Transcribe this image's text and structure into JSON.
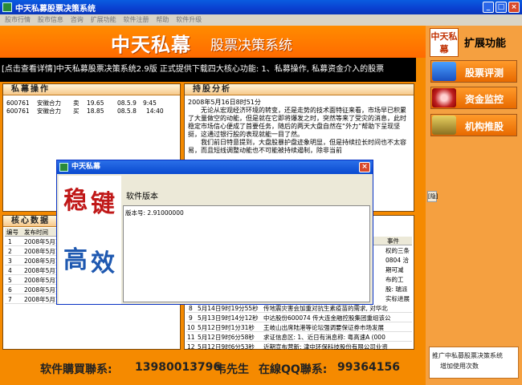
{
  "window": {
    "title": "中天私募股票决策系统",
    "min": "_",
    "max": "□",
    "close": "×"
  },
  "menu": [
    "股市行情",
    "股市信息",
    "咨询",
    "扩展功能",
    "软件注册",
    "帮助",
    "软件升级"
  ],
  "banner": {
    "big": "中天私幕",
    "small": "股票决策系统"
  },
  "ticker": "[点击查看详情]中天私募股票决策系统2.9版 正式提供下载四大核心功能: 1、私募操作, 私募资金介入的股票",
  "private_ops": {
    "title": "私幕操作",
    "rows": [
      {
        "code": "600761",
        "name": "安徽合力",
        "side": "卖",
        "price": "19.65",
        "date": "08.5.9",
        "time": "9:45"
      },
      {
        "code": "600761",
        "name": "安徽合力",
        "side": "买",
        "price": "18.85",
        "date": "08.5.8",
        "time": "14:40"
      }
    ]
  },
  "analysis": {
    "title": "持股分析",
    "date": "2008年5月16日8时51分",
    "paragraphs": [
      "无论从宏观经济环境的转变，还是走势的技术面特征来看，市场早已积累了大量做空的动能，但是就在它即将爆发之时，突然等来了受灾的消息，此时稳定市场信心便成了首要任务，随后的两天大盘自然在“外力”帮助下呈现坚挺，这通过银行股的表现就能一目了然。",
      "我们前日特意提到，大盘股暴护盘迹象明显，但是持续拉长时间也不太容易，而且短线调整动能也不可能被持续遏制，除非当前"
    ]
  },
  "core_data": {
    "title": "核心数据",
    "headers": [
      "编号",
      "发布时间"
    ],
    "rows": [
      {
        "no": "1",
        "time": "2008年5月16"
      },
      {
        "no": "2",
        "time": "2008年5月15"
      },
      {
        "no": "3",
        "time": "2008年5月15"
      },
      {
        "no": "4",
        "time": "2008年5月14"
      },
      {
        "no": "5",
        "time": "2008年5月13"
      },
      {
        "no": "6",
        "time": "2008年5月12"
      },
      {
        "no": "7",
        "time": "2008年5月12"
      }
    ]
  },
  "events": {
    "header_event": "事件",
    "partial_right": [
      "权的三条",
      "0804 洽",
      "期可减",
      "布的工",
      "股: 瑞派",
      "实标进展"
    ],
    "rows": [
      {
        "no": "8",
        "time": "5月14日9时19分55秒",
        "event": "传地震灾害会加重对抗生素疫苗的需求, 对华北"
      },
      {
        "no": "9",
        "time": "5月13日9时14分12秒",
        "event": "中达股份600074 传大连金融控股集团重组该公"
      },
      {
        "no": "10",
        "time": "5月12日9时1分31秒",
        "event": "王岐山出席陆港等论坛强调要保证券市场发展"
      },
      {
        "no": "11",
        "time": "5月12日9时6分58秒",
        "event": "求证信息区: 1、近日有消息称: 粤高速A (000"
      },
      {
        "no": "12",
        "time": "5月12日9时6分53秒",
        "event": "近期宣布营新: 津中环保科技股份有限公司业资"
      }
    ]
  },
  "footer": {
    "label": "软件購買聯系:",
    "phone": "13980013796",
    "contact": "韦先生",
    "qq_label": "在線QQ聯系:",
    "qq": "99364156"
  },
  "sidebar": {
    "logo": "中天私幕",
    "title": "扩展功能",
    "buttons": [
      "股票评测",
      "资金监控",
      "机构推股"
    ],
    "tab": "[隐]",
    "promo": [
      "推广中私募股票决策系统",
      "增加使用次数"
    ]
  },
  "dialog": {
    "title": "中天私幕",
    "close": "×",
    "art": [
      "稳",
      "键",
      "高",
      "效"
    ],
    "label": "软件版本",
    "version": "版本号: 2.91000000"
  }
}
